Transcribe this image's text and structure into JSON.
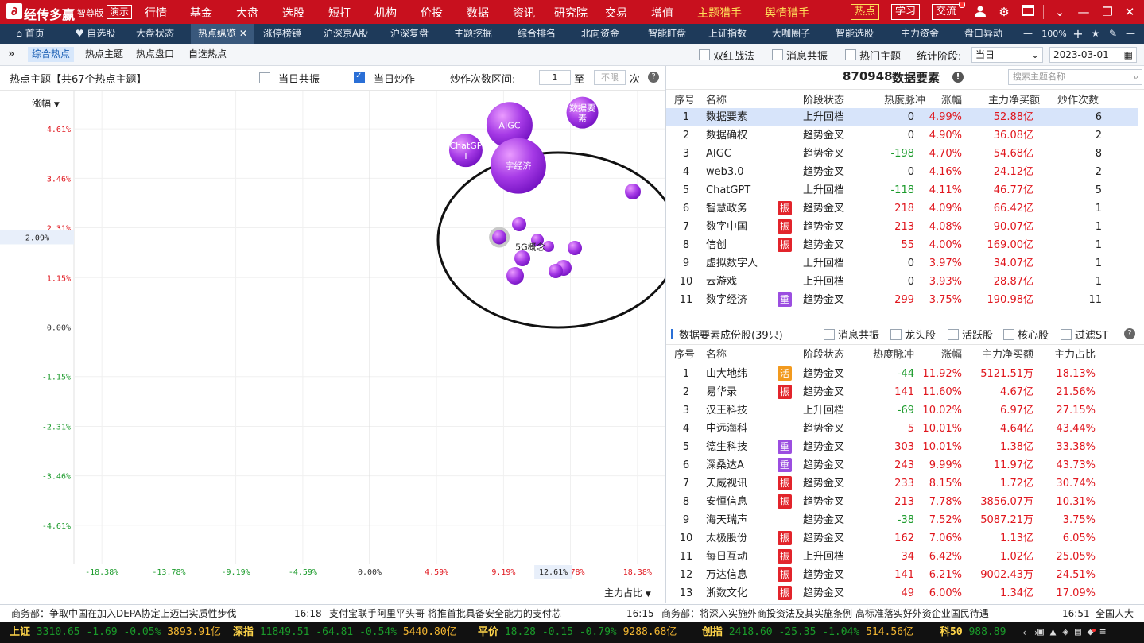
{
  "app": {
    "name": "经传多赢",
    "edition": "智尊版",
    "demo": "演示",
    "nav": [
      "行情",
      "基金",
      "大盘",
      "选股",
      "短打",
      "机构",
      "价投",
      "数据",
      "资讯",
      "研究院",
      "交易",
      "增值"
    ],
    "nav_highlight": [
      "主题猎手",
      "舆情猎手"
    ],
    "buttons": [
      "热点",
      "学习",
      "交流"
    ]
  },
  "tabs": {
    "home": "首页",
    "items": [
      "自选股",
      "大盘状态",
      "热点纵览",
      "涨停榜镜",
      "沪深京A股",
      "沪深复盘",
      "主题挖掘",
      "综合排名",
      "北向资金",
      "智能盯盘",
      "上证指数",
      "大咖圈子",
      "智能选股",
      "主力资金",
      "盘口异动"
    ],
    "active_index": 2,
    "zoom": "100%"
  },
  "subbar": {
    "tabs": [
      "综合热点",
      "热点主题",
      "热点盘口",
      "自选热点"
    ],
    "options": [
      "双红战法",
      "消息共振",
      "热门主题"
    ],
    "stat_label": "统计阶段:",
    "stat_value": "当日",
    "date": "2023-03-01"
  },
  "chart_header": {
    "title": "热点主题【共67个热点主题】",
    "opt1": "当日共振",
    "opt2": "当日炒作",
    "range_label": "炒作次数区间:",
    "range_from": "1",
    "range_to_label": "至",
    "range_to": "不限",
    "range_unit": "次"
  },
  "chart_data": {
    "type": "scatter",
    "title": "",
    "ylabel": "涨幅",
    "xlabel": "主力占比",
    "y_ticks": [
      "4.61%",
      "3.46%",
      "2.31%",
      "1.15%",
      "0.00%",
      "-1.15%",
      "-2.31%",
      "-3.46%",
      "-4.61%"
    ],
    "x_ticks": [
      "-18.38%",
      "-13.78%",
      "-9.19%",
      "-4.59%",
      "0.00%",
      "4.59%",
      "9.19%",
      "13.78%",
      "18.38%"
    ],
    "current_y": "2.09%",
    "current_x": "12.61%",
    "points": [
      {
        "label": "AIGC",
        "x": 9.6,
        "y": 4.7
      },
      {
        "label": "数字经济",
        "x": 10.2,
        "y": 3.75
      },
      {
        "label": "ChatGPT",
        "x": 6.6,
        "y": 4.11
      },
      {
        "label": "数据要素",
        "x": 14.6,
        "y": 4.99
      },
      {
        "label": "5G概念",
        "x": 8.9,
        "y": 2.09
      }
    ]
  },
  "topics_panel": {
    "code": "870948",
    "name": "数据要素",
    "search_placeholder": "搜索主题名称",
    "headers": [
      "序号",
      "名称",
      "阶段状态",
      "热度脉冲",
      "涨幅",
      "主力净买额",
      "炒作次数"
    ],
    "rows": [
      {
        "no": "1",
        "name": "数据要素",
        "tag": "",
        "state": "上升回档",
        "pulse": "0",
        "chg": "4.99%",
        "net": "52.88亿",
        "times": "6"
      },
      {
        "no": "2",
        "name": "数据确权",
        "tag": "",
        "state": "趋势金叉",
        "pulse": "0",
        "chg": "4.90%",
        "net": "36.08亿",
        "times": "2"
      },
      {
        "no": "3",
        "name": "AIGC",
        "tag": "",
        "state": "趋势金叉",
        "pulse": "-198",
        "chg": "4.70%",
        "net": "54.68亿",
        "times": "8"
      },
      {
        "no": "4",
        "name": "web3.0",
        "tag": "",
        "state": "趋势金叉",
        "pulse": "0",
        "chg": "4.16%",
        "net": "24.12亿",
        "times": "2"
      },
      {
        "no": "5",
        "name": "ChatGPT",
        "tag": "",
        "state": "上升回档",
        "pulse": "-118",
        "chg": "4.11%",
        "net": "46.77亿",
        "times": "5"
      },
      {
        "no": "6",
        "name": "智慧政务",
        "tag": "振",
        "state": "趋势金叉",
        "pulse": "218",
        "chg": "4.09%",
        "net": "66.42亿",
        "times": "1"
      },
      {
        "no": "7",
        "name": "数字中国",
        "tag": "振",
        "state": "趋势金叉",
        "pulse": "213",
        "chg": "4.08%",
        "net": "90.07亿",
        "times": "1"
      },
      {
        "no": "8",
        "name": "信创",
        "tag": "振",
        "state": "趋势金叉",
        "pulse": "55",
        "chg": "4.00%",
        "net": "169.00亿",
        "times": "1"
      },
      {
        "no": "9",
        "name": "虚拟数字人",
        "tag": "",
        "state": "上升回档",
        "pulse": "0",
        "chg": "3.97%",
        "net": "34.07亿",
        "times": "1"
      },
      {
        "no": "10",
        "name": "云游戏",
        "tag": "",
        "state": "上升回档",
        "pulse": "0",
        "chg": "3.93%",
        "net": "28.87亿",
        "times": "1"
      },
      {
        "no": "11",
        "name": "数字经济",
        "tag": "重",
        "state": "趋势金叉",
        "pulse": "299",
        "chg": "3.75%",
        "net": "190.98亿",
        "times": "11"
      }
    ]
  },
  "stocks_panel": {
    "title": "数据要素成份股(39只)",
    "filters": [
      "消息共振",
      "龙头股",
      "活跃股",
      "核心股",
      "过滤ST"
    ],
    "headers": [
      "序号",
      "名称",
      "阶段状态",
      "热度脉冲",
      "涨幅",
      "主力净买额",
      "主力占比"
    ],
    "rows": [
      {
        "no": "1",
        "name": "山大地纬",
        "tag": "活",
        "state": "趋势金叉",
        "pulse": "-44",
        "chg": "11.92%",
        "net": "5121.51万",
        "ratio": "18.13%"
      },
      {
        "no": "2",
        "name": "易华录",
        "tag": "振",
        "state": "趋势金叉",
        "pulse": "141",
        "chg": "11.60%",
        "net": "4.67亿",
        "ratio": "21.56%"
      },
      {
        "no": "3",
        "name": "汉王科技",
        "tag": "",
        "state": "上升回档",
        "pulse": "-69",
        "chg": "10.02%",
        "net": "6.97亿",
        "ratio": "27.15%"
      },
      {
        "no": "4",
        "name": "中远海科",
        "tag": "",
        "state": "趋势金叉",
        "pulse": "5",
        "chg": "10.01%",
        "net": "4.64亿",
        "ratio": "43.44%"
      },
      {
        "no": "5",
        "name": "德生科技",
        "tag": "重",
        "state": "趋势金叉",
        "pulse": "303",
        "chg": "10.01%",
        "net": "1.38亿",
        "ratio": "33.38%"
      },
      {
        "no": "6",
        "name": "深桑达A",
        "tag": "重",
        "state": "趋势金叉",
        "pulse": "243",
        "chg": "9.99%",
        "net": "11.97亿",
        "ratio": "43.73%"
      },
      {
        "no": "7",
        "name": "天威视讯",
        "tag": "振",
        "state": "趋势金叉",
        "pulse": "233",
        "chg": "8.15%",
        "net": "1.72亿",
        "ratio": "30.74%"
      },
      {
        "no": "8",
        "name": "安恒信息",
        "tag": "振",
        "state": "趋势金叉",
        "pulse": "213",
        "chg": "7.78%",
        "net": "3856.07万",
        "ratio": "10.31%"
      },
      {
        "no": "9",
        "name": "海天瑞声",
        "tag": "",
        "state": "趋势金叉",
        "pulse": "-38",
        "chg": "7.52%",
        "net": "5087.21万",
        "ratio": "3.75%"
      },
      {
        "no": "10",
        "name": "太极股份",
        "tag": "振",
        "state": "趋势金叉",
        "pulse": "162",
        "chg": "7.06%",
        "net": "1.13亿",
        "ratio": "6.05%"
      },
      {
        "no": "11",
        "name": "每日互动",
        "tag": "振",
        "state": "上升回档",
        "pulse": "34",
        "chg": "6.42%",
        "net": "1.02亿",
        "ratio": "25.05%"
      },
      {
        "no": "12",
        "name": "万达信息",
        "tag": "振",
        "state": "趋势金叉",
        "pulse": "141",
        "chg": "6.21%",
        "net": "9002.43万",
        "ratio": "24.51%"
      },
      {
        "no": "13",
        "name": "浙数文化",
        "tag": "振",
        "state": "趋势金叉",
        "pulse": "49",
        "chg": "6.00%",
        "net": "1.34亿",
        "ratio": "17.09%"
      }
    ]
  },
  "news": [
    {
      "time": "",
      "text": "商务部：争取中国在加入DEPA协定上迈出实质性步伐"
    },
    {
      "time": "16:18",
      "text": "支付宝联手阿里平头哥 将推首批具备安全能力的支付芯"
    },
    {
      "time": "16:15",
      "text": "商务部：将深入实施外商投资法及其实施条例 高标准落实好外资企业国民待遇"
    },
    {
      "time": "16:51",
      "text": "全国人大"
    }
  ],
  "indices": [
    {
      "name": "上证",
      "value": "3310.65",
      "chg": "-1.69",
      "pct": "-0.05%",
      "amount": "3893.91亿"
    },
    {
      "name": "深指",
      "value": "11849.51",
      "chg": "-64.81",
      "pct": "-0.54%",
      "amount": "5440.80亿"
    },
    {
      "name": "平价",
      "value": "18.28",
      "chg": "-0.15",
      "pct": "-0.79%",
      "amount": "9288.68亿"
    },
    {
      "name": "创指",
      "value": "2418.60",
      "chg": "-25.35",
      "pct": "-1.04%",
      "amount": "514.56亿"
    },
    {
      "name": "科50",
      "value": "988.89",
      "chg": "",
      "pct": "",
      "amount": ""
    }
  ],
  "colors": {
    "brand": "#c8101e",
    "up": "#e0161d",
    "down": "#1a9a2a",
    "bubble": "#9b2fe0",
    "highlight": "#d7e4fa"
  }
}
